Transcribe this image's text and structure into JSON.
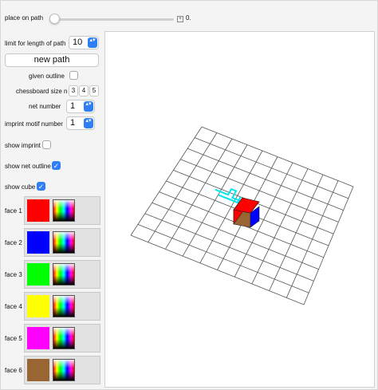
{
  "controls": {
    "place_on_path": {
      "label": "place on path",
      "value": "0."
    },
    "path_length": {
      "label": "limit for length of path",
      "value": "10"
    },
    "new_path_button": "new path",
    "given_outline": {
      "label": "given outline",
      "checked": false
    },
    "chessboard_size": {
      "label": "chessboard size n",
      "options": [
        "3",
        "4",
        "5"
      ]
    },
    "net_number": {
      "label": "net number",
      "value": "1"
    },
    "imprint_motif": {
      "label": "imprint motif number",
      "value": "1"
    },
    "show_imprint": {
      "label": "show imprint",
      "checked": false
    },
    "show_net_outline": {
      "label": "show net outline",
      "checked": true
    },
    "show_cube": {
      "label": "show cube",
      "checked": true
    }
  },
  "faces": [
    {
      "label": "face 1",
      "color": "#ff0000"
    },
    {
      "label": "face 2",
      "color": "#0000ff"
    },
    {
      "label": "face 3",
      "color": "#00ff00"
    },
    {
      "label": "face 4",
      "color": "#ffff00"
    },
    {
      "label": "face 5",
      "color": "#ff00ff"
    },
    {
      "label": "face 6",
      "color": "#996633"
    }
  ],
  "checkmark": "✓",
  "dropdown_arrows": "▴▾",
  "plus_glyph": "+"
}
